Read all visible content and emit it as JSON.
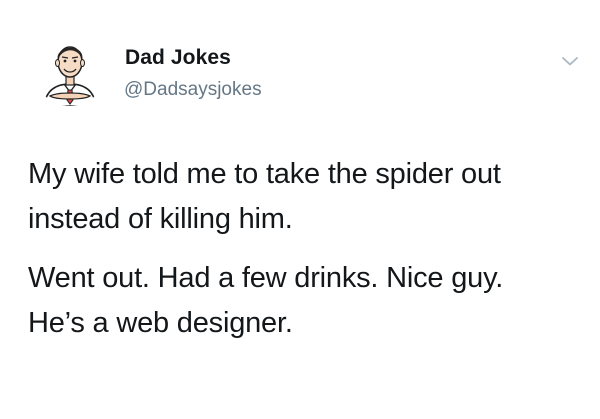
{
  "tweet": {
    "author": {
      "display_name": "Dad Jokes",
      "handle": "@Dadsaysjokes",
      "avatar_icon": "dad-cartoon-avatar"
    },
    "menu_icon": "chevron-down-icon",
    "lines": [
      "My wife told me to take the spider out",
      "instead of killing him.",
      "Went out. Had a few drinks. Nice guy.",
      "He’s a web designer."
    ]
  },
  "colors": {
    "text_primary": "#14171a",
    "text_secondary": "#657786",
    "chevron": "#aab8c2",
    "background": "#ffffff"
  }
}
